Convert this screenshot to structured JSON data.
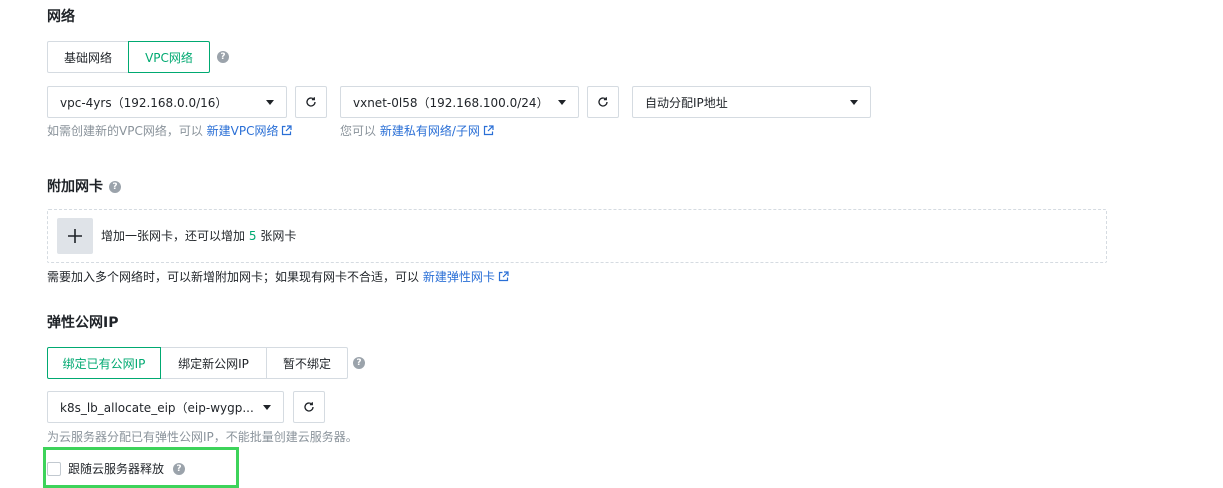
{
  "network": {
    "title": "网络",
    "tabs": [
      "基础网络",
      "VPC网络"
    ],
    "active_tab": "VPC网络",
    "vpc_select": "vpc-4yrs（192.168.0.0/16）",
    "vxnet_select": "vxnet-0l58（192.168.100.0/24）",
    "ip_select": "自动分配IP地址",
    "vpc_hint": "如需创建新的VPC网络，可以",
    "vpc_link": "新建VPC网络",
    "vxnet_hint": "您可以",
    "vxnet_link": "新建私有网络/子网"
  },
  "nic": {
    "title": "附加网卡",
    "add_text_before": "增加一张网卡，还可以增加",
    "add_count": "5",
    "add_text_after": "张网卡",
    "hint": "需要加入多个网络时，可以新增附加网卡；如果现有网卡不合适，可以",
    "link": "新建弹性网卡"
  },
  "eip": {
    "title": "弹性公网IP",
    "tabs": [
      "绑定已有公网IP",
      "绑定新公网IP",
      "暂不绑定"
    ],
    "active_tab": "绑定已有公网IP",
    "select": "k8s_lb_allocate_eip（eip-wygp...",
    "hint": "为云服务器分配已有弹性公网IP，不能批量创建云服务器。",
    "checkbox_label": "跟随云服务器释放",
    "checkbox_checked": false
  },
  "colors": {
    "accent": "#00a971",
    "link": "#2a6fd6",
    "highlight": "#3dd35a"
  }
}
